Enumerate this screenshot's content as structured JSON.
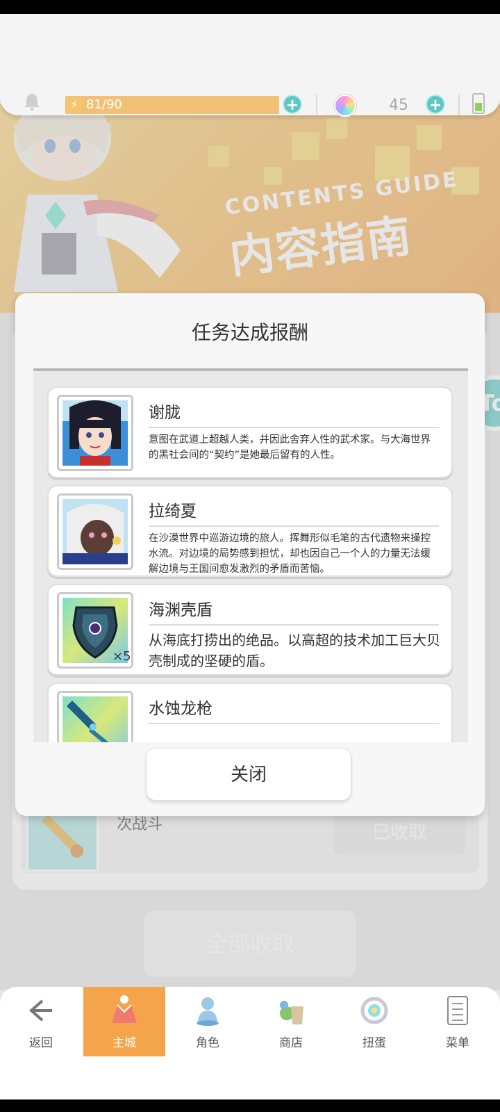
{
  "status": {
    "energy": "81/90",
    "energy_fraction": 0.9,
    "gem_count": "45",
    "icons": [
      "bell-icon",
      "energy-icon",
      "plus-icon",
      "gem-icon",
      "battery-icon"
    ]
  },
  "banner": {
    "title_en": "CONTENTS GUIDE",
    "title_cn": "内容指南"
  },
  "background": {
    "item_subtitle": "次战斗",
    "claimed_label": "已收取",
    "collect_all_label": "全部收取",
    "side_tab_label": "To"
  },
  "dialog": {
    "title": "任务达成报酬",
    "rewards": [
      {
        "name": "谢胧",
        "desc": "意图在武道上超越人类，并因此舍弃人性的武术家。与大海世界的黑社会间的“契约”是她最后留有的人性。",
        "thumb": "portrait-xie-long"
      },
      {
        "name": "拉绮夏",
        "desc": "在沙漠世界中巡游边境的旅人。挥舞形似毛笔的古代遗物来操控水流。对边境的局势感到担忧，却也因自己一个人的力量无法缓解边境与王国间愈发激烈的矛盾而苦恼。",
        "thumb": "portrait-la-qi-xia"
      },
      {
        "name": "海渊壳盾",
        "desc": "从海底打捞出的绝品。以高超的技术加工巨大贝壳制成的坚硬的盾。",
        "qty": "×5",
        "thumb": "shield-icon"
      },
      {
        "name": "水蚀龙枪",
        "desc": "",
        "thumb": "spear-icon"
      }
    ],
    "close_label": "关闭"
  },
  "nav": {
    "items": [
      {
        "label": "返回",
        "icon": "back-arrow-icon"
      },
      {
        "label": "主城",
        "icon": "castle-icon",
        "active": true
      },
      {
        "label": "角色",
        "icon": "character-icon"
      },
      {
        "label": "商店",
        "icon": "shop-icon"
      },
      {
        "label": "扭蛋",
        "icon": "gacha-icon"
      },
      {
        "label": "菜单",
        "icon": "menu-icon"
      }
    ]
  }
}
